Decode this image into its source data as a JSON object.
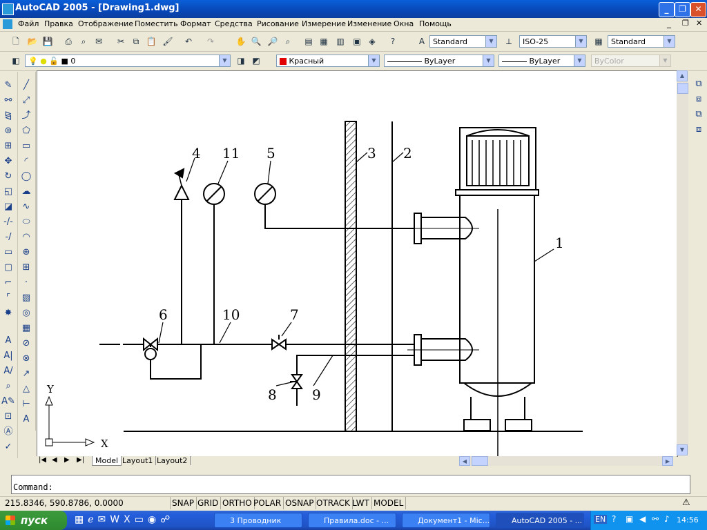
{
  "window": {
    "title": "AutoCAD 2005 - [Drawing1.dwg]"
  },
  "menu": [
    "Файл",
    "Правка",
    "Отображение",
    "Поместить",
    "Формат",
    "Средства",
    "Рисование",
    "Измерение",
    "Изменение",
    "Окна",
    "Помощь"
  ],
  "styles": {
    "text_style": "Standard",
    "dim_style": "ISO-25",
    "table_style": "Standard"
  },
  "layers": {
    "current_layer": "0",
    "color": "Красный",
    "linetype": "ByLayer",
    "lineweight": "ByLayer",
    "plotstyle": "ByColor"
  },
  "drawing": {
    "labels": [
      "1",
      "2",
      "3",
      "4",
      "5",
      "6",
      "7",
      "8",
      "9",
      "10",
      "11"
    ],
    "ucs": {
      "x": "X",
      "y": "Y"
    }
  },
  "tabs": [
    "Model",
    "Layout1",
    "Layout2"
  ],
  "command": {
    "prompt": "Command:"
  },
  "status": {
    "coords": "215.8346, 590.8786, 0.0000",
    "buttons": [
      "SNAP",
      "GRID",
      "ORTHO",
      "POLAR",
      "OSNAP",
      "OTRACK",
      "LWT",
      "MODEL"
    ]
  },
  "taskbar": {
    "start": "пуск",
    "tasks": [
      "3 Проводник",
      "Правила.doc - ...",
      "Документ1 - Mic...",
      "AutoCAD 2005 - ..."
    ],
    "lang": "EN",
    "clock": "14:56"
  },
  "colors": {
    "titlebar": "#0a5fd8",
    "taskbar": "#245edb",
    "start": "#3c9a3c",
    "layer_color": "#e00000"
  }
}
